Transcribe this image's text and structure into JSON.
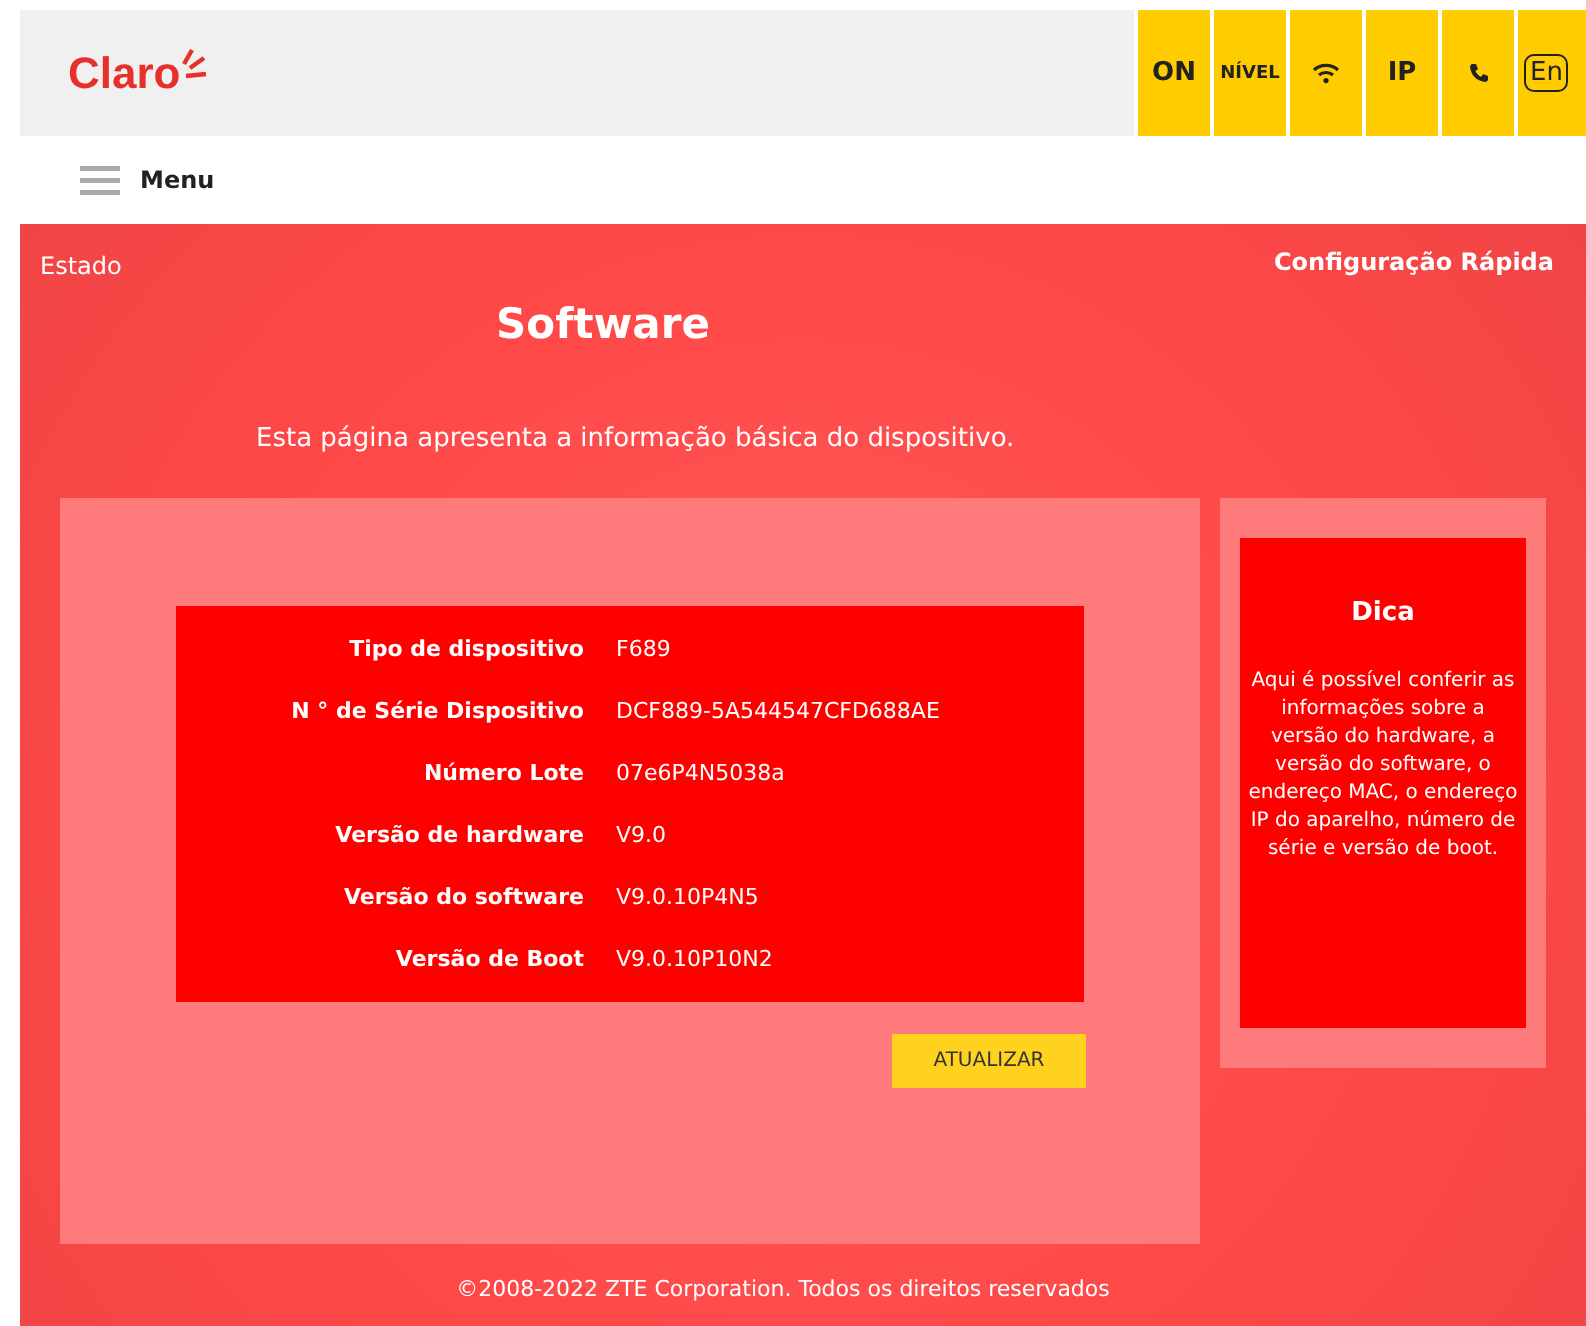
{
  "header": {
    "logo": "Claro",
    "status_buttons": [
      {
        "kind": "text",
        "label": "ON"
      },
      {
        "kind": "text",
        "label": "NÍVEL"
      },
      {
        "kind": "wifi"
      },
      {
        "kind": "text",
        "label": "IP"
      },
      {
        "kind": "phone"
      },
      {
        "kind": "lang",
        "label": "En"
      }
    ]
  },
  "menu": {
    "label": "Menu"
  },
  "breadcrumb": "Estado",
  "quick_setup": "Configuração Rápida",
  "title": "Software",
  "description": "Esta página apresenta a informação básica do dispositivo.",
  "info_rows": [
    {
      "label": "Tipo de dispositivo",
      "value": "F689"
    },
    {
      "label": "N ° de Série Dispositivo",
      "value": "DCF889-5A544547CFD688AE"
    },
    {
      "label": "Número Lote",
      "value": "07e6P4N5038a"
    },
    {
      "label": "Versão de hardware",
      "value": "V9.0"
    },
    {
      "label": "Versão do software",
      "value": "V9.0.10P4N5"
    },
    {
      "label": "Versão de Boot",
      "value": "V9.0.10P10N2"
    }
  ],
  "update_button": "ATUALIZAR",
  "tip": {
    "title": "Dica",
    "text": "Aqui é possível conferir as informações sobre a versão do hardware, a versão do software, o endereço MAC, o endereço IP do aparelho, número de série e versão de boot."
  },
  "footer": "©2008-2022 ZTE Corporation. Todos os direitos reservados"
}
